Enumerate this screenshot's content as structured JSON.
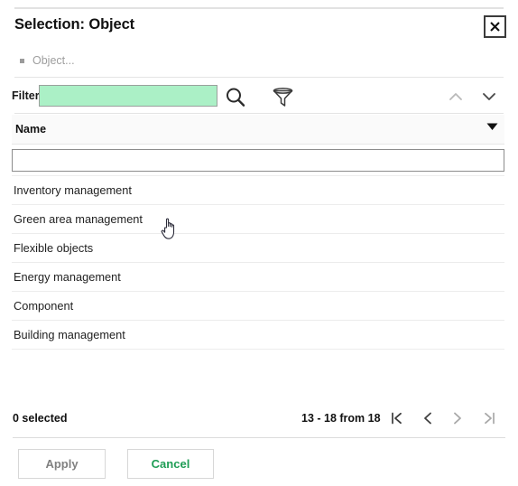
{
  "dialog": {
    "title": "Selection: Object",
    "close_label": "×"
  },
  "breadcrumb": {
    "items": [
      {
        "label": "Object..."
      }
    ]
  },
  "filter_bar": {
    "label": "Filter",
    "value": "",
    "placeholder": "",
    "search_icon": "search-icon",
    "funnel_icon": "filter-funnel-icon",
    "scroll_up_icon": "chevron-up-icon",
    "scroll_down_icon": "chevron-down-icon"
  },
  "table": {
    "columns": [
      {
        "header": "Name",
        "sort_icon": "sort-descending-caret"
      }
    ],
    "column_filter_value": "",
    "column_filter_placeholder": "",
    "rows": [
      {
        "name": "Inventory management"
      },
      {
        "name": "Green area management"
      },
      {
        "name": "Flexible objects"
      },
      {
        "name": "Energy management"
      },
      {
        "name": "Component"
      },
      {
        "name": "Building management"
      }
    ]
  },
  "status": {
    "selected_text": "0 selected",
    "page_info": "13 - 18 from 18",
    "pagination": {
      "first_label": "|<",
      "prev_label": "<",
      "next_label": ">",
      "last_label": ">|"
    }
  },
  "actions": {
    "apply_label": "Apply",
    "cancel_label": "Cancel"
  },
  "colors": {
    "filter_input_green": "#abf0c6",
    "cancel_green": "#1f9d55",
    "apply_grey": "#808080",
    "header_bg": "#fafafa",
    "border_grey": "#e4e4e4"
  }
}
